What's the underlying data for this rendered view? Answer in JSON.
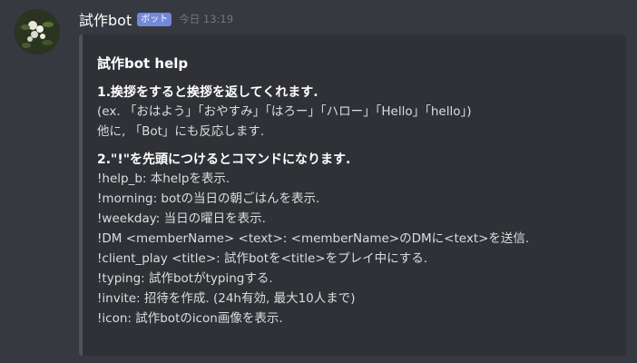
{
  "message": {
    "username": "試作bot",
    "badge": "ボット",
    "timestamp": "今日 13:19"
  },
  "embed": {
    "title": "試作bot help",
    "fields": [
      {
        "name": "1.挨拶をすると挨拶を返してくれます.",
        "lines": [
          "(ex. 「おはよう」「おやすみ」「はろー」「ハロー」「Hello」「hello」)",
          "他に, 「Bot」にも反応します."
        ]
      },
      {
        "name": "2.\"!\"を先頭につけるとコマンドになります.",
        "lines": [
          "!help_b: 本helpを表示.",
          "!morning: botの当日の朝ごはんを表示.",
          "!weekday: 当日の曜日を表示.",
          "!DM <memberName> <text>: <memberName>のDMに<text>を送信.",
          "!client_play <title>: 試作botを<title>をプレイ中にする.",
          "!typing: 試作botがtypingする.",
          "!invite: 招待を作成. (24h有効, 最大10人まで)",
          "!icon: 試作botのicon画像を表示."
        ]
      }
    ]
  },
  "colors": {
    "background": "#36393f",
    "embed_background": "#2f3136",
    "embed_bar": "#4f545c",
    "badge": "#7289da"
  }
}
